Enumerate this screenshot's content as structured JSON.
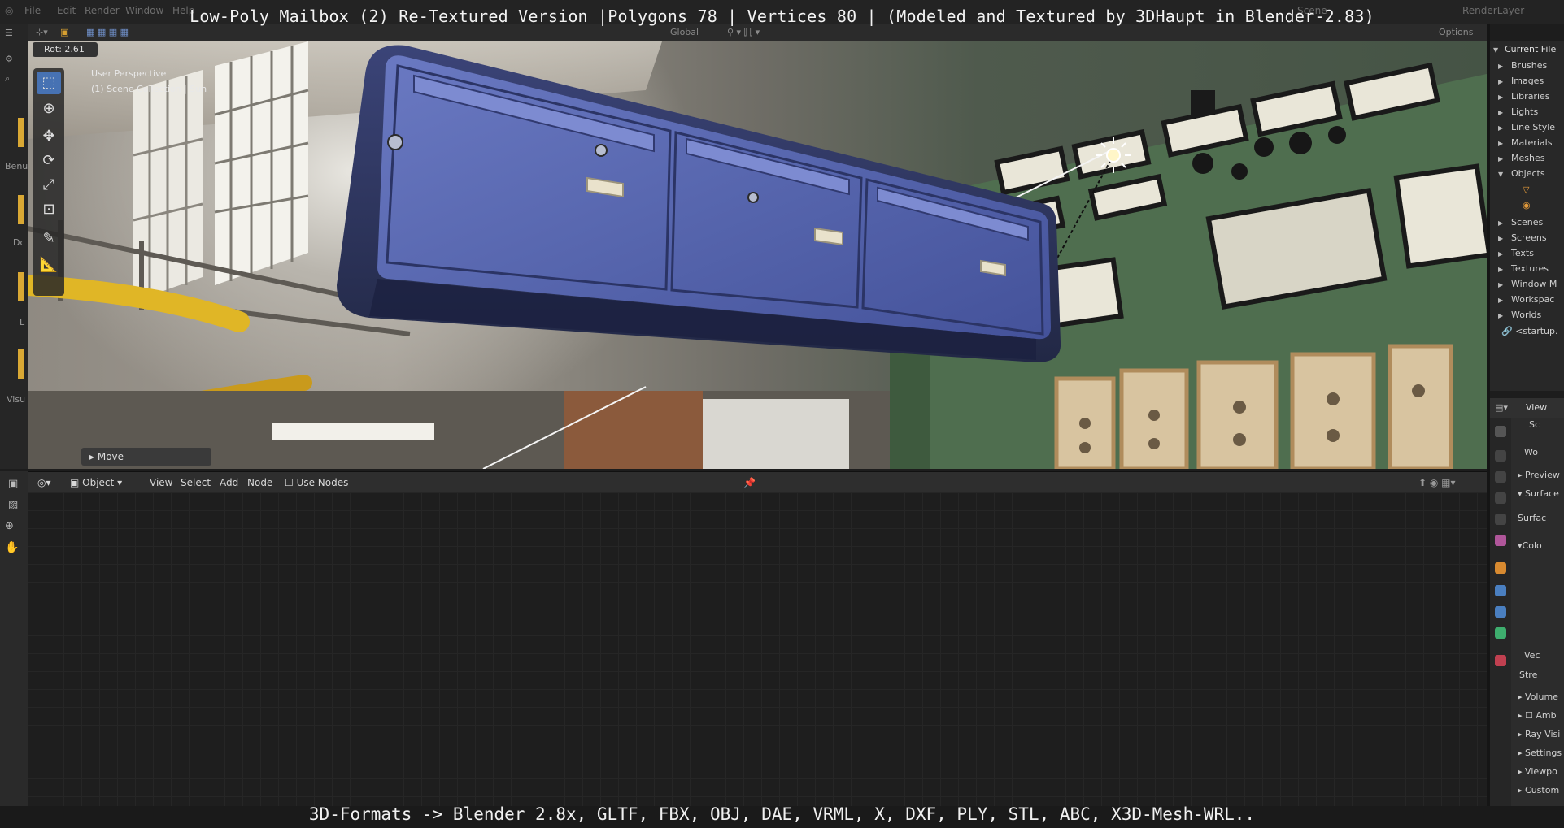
{
  "video": {
    "title_overlay": "Low-Poly Mailbox (2) Re-Textured Version |Polygons 78 | Vertices 80 | (Modeled and Textured by 3DHaupt in Blender-2.83)",
    "caption_overlay": "3D-Formats -> Blender 2.8x, GLTF, FBX, OBJ, DAE, VRML, X, DXF, PLY, STL, ABC, X3D-Mesh-WRL.."
  },
  "menu": {
    "items": [
      "File",
      "Edit",
      "Render",
      "Window",
      "Help"
    ],
    "scene": "Scene",
    "render_layer": "RenderLayer"
  },
  "viewport": {
    "transform_orientation": "Global",
    "options": "Options",
    "rotation_readout": "Rot: 2.61",
    "perspective_label": "User Perspective",
    "collection_label": "(1) Scene Collection | Sun",
    "last_operator": "Move"
  },
  "left_strip": {
    "labels": [
      "Benu",
      "Dc",
      "L",
      "Visu"
    ]
  },
  "node_editor": {
    "mode": "Object",
    "menus": [
      "View",
      "Select",
      "Add",
      "Node"
    ],
    "use_nodes_label": "Use Nodes"
  },
  "outliner": {
    "title": "Current File",
    "items": [
      {
        "label": "Brushes",
        "expanded": false
      },
      {
        "label": "Images",
        "expanded": false
      },
      {
        "label": "Libraries",
        "expanded": false
      },
      {
        "label": "Lights",
        "expanded": false
      },
      {
        "label": "Line Style",
        "expanded": false
      },
      {
        "label": "Materials",
        "expanded": false
      },
      {
        "label": "Meshes",
        "expanded": false
      },
      {
        "label": "Objects",
        "expanded": true
      },
      {
        "label": "Scenes",
        "expanded": false
      },
      {
        "label": "Screens",
        "expanded": false
      },
      {
        "label": "Texts",
        "expanded": false
      },
      {
        "label": "Textures",
        "expanded": false
      },
      {
        "label": "Window M",
        "expanded": false
      },
      {
        "label": "Workspac",
        "expanded": false
      },
      {
        "label": "Worlds",
        "expanded": false
      },
      {
        "label": "<startup.",
        "expanded": false
      }
    ]
  },
  "properties": {
    "view_label": "View",
    "scene_label": "Sc",
    "world_label": "Wo",
    "rows": [
      "Preview",
      "Surface",
      "Surfac",
      "Colo",
      "Vec",
      "Stre",
      "Volume",
      "Amb",
      "Ray Visi",
      "Settings",
      "Viewpo",
      "Custom"
    ]
  },
  "colors": {
    "accent_blue": "#4772b3",
    "mailbox_blue": "#5a6ab0",
    "panel_green": "#4f6e4f",
    "pipe_yellow": "#e0b626"
  }
}
